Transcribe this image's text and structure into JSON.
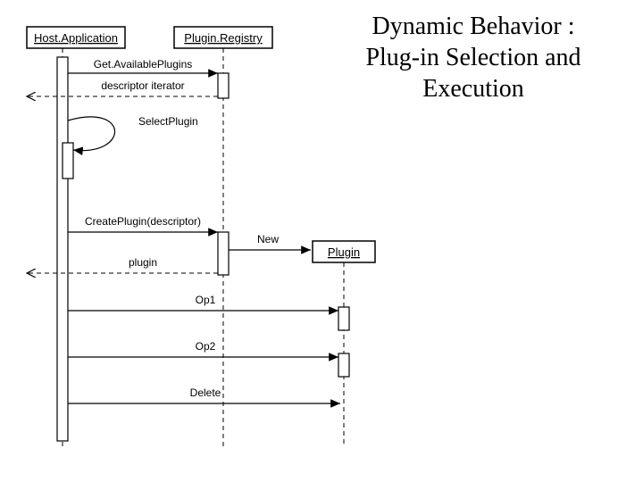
{
  "title": {
    "line1": "Dynamic Behavior :",
    "line2": "Plug-in Selection and",
    "line3": "Execution"
  },
  "lifelines": {
    "host": "Host.Application",
    "registry": "Plugin.Registry",
    "plugin": "Plugin"
  },
  "messages": {
    "get_available": "Get.AvailablePlugins",
    "descriptor_iterator": "descriptor iterator",
    "select_plugin": "SelectPlugin",
    "create_plugin": "CreatePlugin(descriptor)",
    "new": "New",
    "plugin_return": "plugin",
    "op1": "Op1",
    "op2": "Op2",
    "delete": "Delete"
  }
}
